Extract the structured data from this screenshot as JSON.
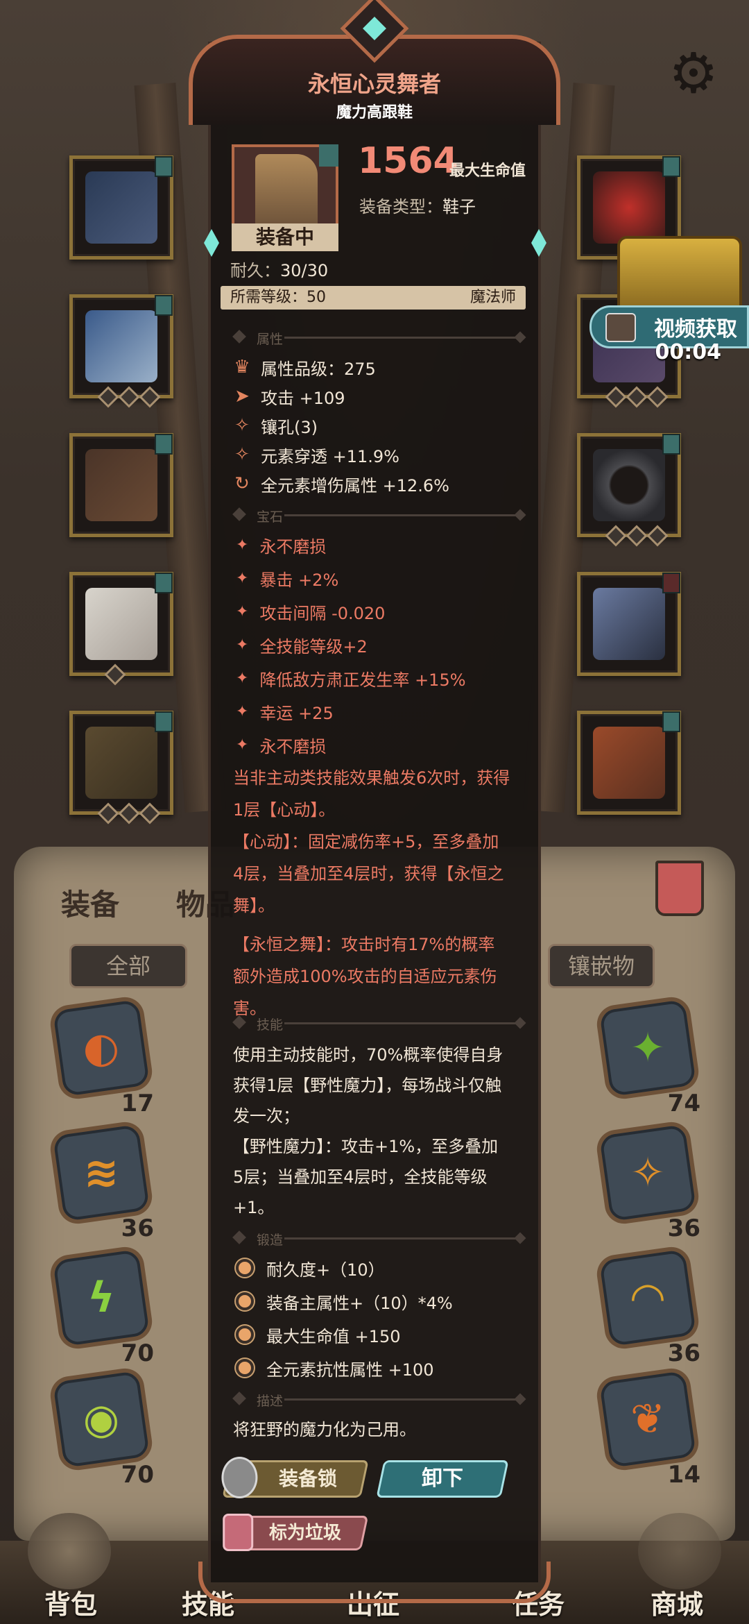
{
  "title": "永恒心灵舞者",
  "subtitle": "魔力高跟鞋",
  "item": {
    "main_value": "1564",
    "main_value_label": "最大生命值",
    "type_label": "装备类型：",
    "type_value": "鞋子",
    "equipped_label": "装备中",
    "durability_label": "耐久：",
    "durability_value": "30/30",
    "req_level_label": "所需等级：50",
    "req_class": "魔法师"
  },
  "sections": {
    "attributes": "属性",
    "gems": "宝石",
    "skills": "技能",
    "forge": "锻造",
    "description": "描述"
  },
  "attributes": [
    {
      "icon": "quality-icon",
      "text": "属性品级：275"
    },
    {
      "icon": "attack-icon",
      "text": "攻击 +109"
    },
    {
      "icon": "socket-icon",
      "text": "镶孔(3)"
    },
    {
      "icon": "penetration-icon",
      "text": "元素穿透 +11.9%"
    },
    {
      "icon": "element-damage-icon",
      "text": "全元素增伤属性 +12.6%"
    }
  ],
  "gem_effects": [
    "永不磨损",
    "暴击 +2%",
    "攻击间隔 -0.020",
    "全技能等级+2",
    "降低敌方肃正发生率 +15%",
    "幸运 +25",
    "永不磨损"
  ],
  "gem_desc_lines": [
    "当非主动类技能效果触发6次时，获得",
    "1层【心动】。",
    "【心动】：固定减伤率+5，至多叠加",
    "4层，当叠加至4层时，获得【永恒之",
    "舞】。",
    "【永恒之舞】：攻击时有17%的概率",
    "额外造成100%攻击的自适应元素伤",
    "害。"
  ],
  "skill_lines": [
    "使用主动技能时，70%概率使得自身",
    "获得1层【野性魔力】，每场战斗仅触",
    "发一次；",
    "【野性魔力】：攻击+1%，至多叠加",
    "5层；当叠加至4层时，全技能等级",
    "+1。"
  ],
  "forge_rows": [
    "耐久度+（10）",
    "装备主属性+（10）*4%",
    "最大生命值 +150",
    "全元素抗性属性 +100"
  ],
  "description_text": "将狂野的魔力化为己用。",
  "buttons": {
    "lock": "装备锁",
    "unload": "卸下",
    "junk": "标为垃圾"
  },
  "side": {
    "video": "视频获取",
    "timer": "00:04"
  },
  "bag": {
    "tab_equip": "装备",
    "tab_items": "物品",
    "filter_all": "全部",
    "filter_inlay": "镶嵌物",
    "left_counts": [
      "17",
      "36",
      "70",
      "70"
    ],
    "right_counts": [
      "74",
      "36",
      "36",
      "14"
    ]
  },
  "nav": [
    "背包",
    "技能",
    "出征",
    "任务",
    "商城"
  ],
  "colors": {
    "accent_red": "#ec7a64",
    "title_pink": "#f0a48a",
    "frame_copper": "#b46a48",
    "teal": "#2e6f76"
  }
}
